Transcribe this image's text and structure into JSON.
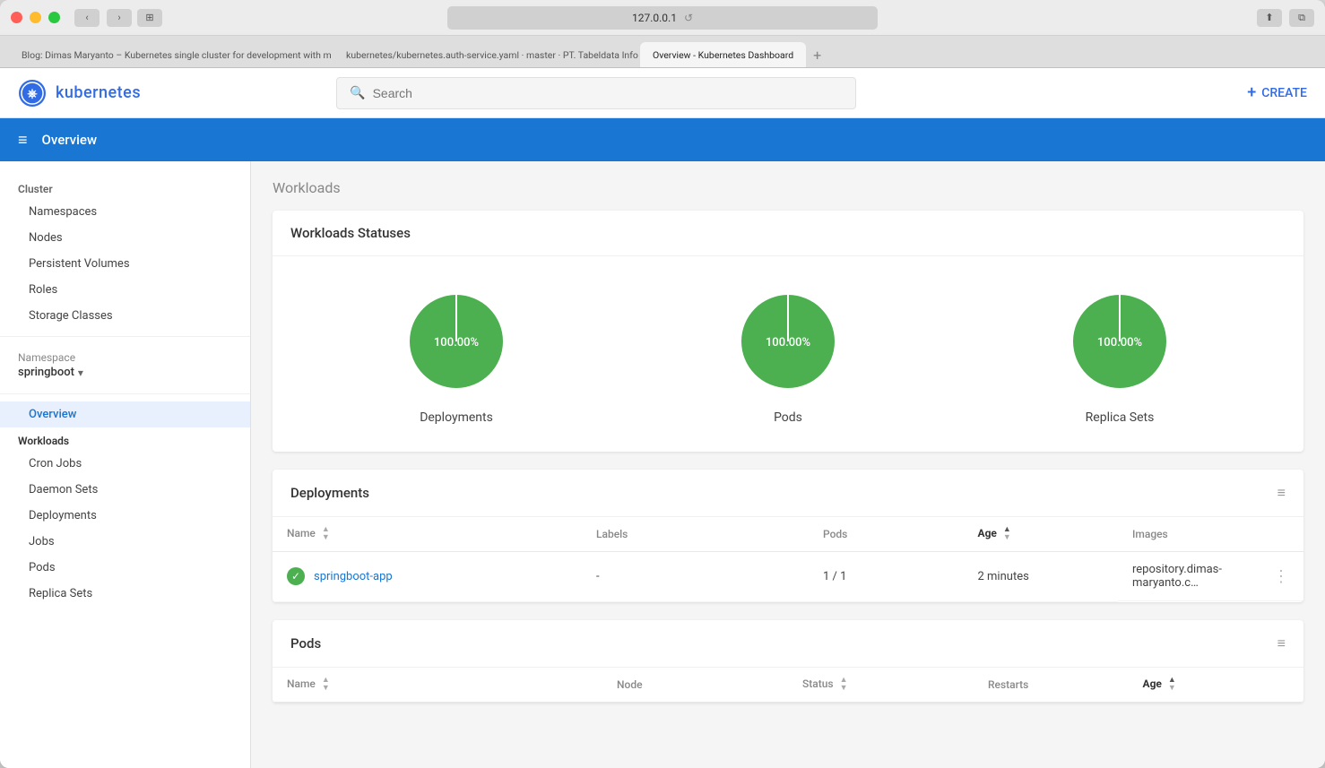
{
  "window": {
    "url": "127.0.0.1",
    "reload_icon": "↺"
  },
  "tabs": [
    {
      "label": "Blog: Dimas Maryanto – Kubernetes single cluster for development with minikube",
      "active": false
    },
    {
      "label": "kubernetes/kubernetes.auth-service.yaml · master · PT. Tabeldata Infomatika...",
      "active": false
    },
    {
      "label": "Overview - Kubernetes Dashboard",
      "active": true
    }
  ],
  "header": {
    "logo_alt": "kubernetes-logo",
    "title": "kubernetes",
    "search_placeholder": "Search",
    "create_label": "CREATE"
  },
  "sub_header": {
    "title": "Overview",
    "hamburger": "≡"
  },
  "sidebar": {
    "cluster_title": "Cluster",
    "cluster_items": [
      {
        "label": "Namespaces"
      },
      {
        "label": "Nodes"
      },
      {
        "label": "Persistent Volumes"
      },
      {
        "label": "Roles"
      },
      {
        "label": "Storage Classes"
      }
    ],
    "namespace_label": "Namespace",
    "namespace_value": "springboot",
    "namespace_arrow": "▾",
    "overview_label": "Overview",
    "workloads_title": "Workloads",
    "workload_items": [
      {
        "label": "Cron Jobs"
      },
      {
        "label": "Daemon Sets"
      },
      {
        "label": "Deployments"
      },
      {
        "label": "Jobs"
      },
      {
        "label": "Pods"
      },
      {
        "label": "Replica Sets"
      }
    ]
  },
  "page_title": "Workloads",
  "workloads_card": {
    "title": "Workloads Statuses",
    "charts": [
      {
        "label": "Deployments",
        "percent": "100.00%",
        "value": 100
      },
      {
        "label": "Pods",
        "percent": "100.00%",
        "value": 100
      },
      {
        "label": "Replica Sets",
        "percent": "100.00%",
        "value": 100
      }
    ]
  },
  "deployments_card": {
    "title": "Deployments",
    "filter_icon": "≡",
    "columns": [
      {
        "label": "Name",
        "sortable": true,
        "bold": false
      },
      {
        "label": "Labels",
        "sortable": false,
        "bold": false
      },
      {
        "label": "Pods",
        "sortable": false,
        "bold": false
      },
      {
        "label": "Age",
        "sortable": true,
        "bold": true,
        "sorted": "asc"
      },
      {
        "label": "Images",
        "sortable": false,
        "bold": false
      }
    ],
    "rows": [
      {
        "status": "ok",
        "name": "springboot-app",
        "labels": "-",
        "pods": "1 / 1",
        "age": "2 minutes",
        "images": "repository.dimas-maryanto.c…"
      }
    ]
  },
  "pods_card": {
    "title": "Pods",
    "filter_icon": "≡",
    "columns": [
      {
        "label": "Name",
        "sortable": true,
        "bold": false
      },
      {
        "label": "Node",
        "sortable": false,
        "bold": false
      },
      {
        "label": "Status",
        "sortable": true,
        "bold": false
      },
      {
        "label": "Restarts",
        "sortable": false,
        "bold": false
      },
      {
        "label": "Age",
        "sortable": true,
        "bold": true,
        "sorted": "asc"
      }
    ]
  },
  "colors": {
    "brand_blue": "#326ce5",
    "nav_blue": "#1976d2",
    "green": "#4caf50",
    "pie_green": "#4caf50"
  }
}
